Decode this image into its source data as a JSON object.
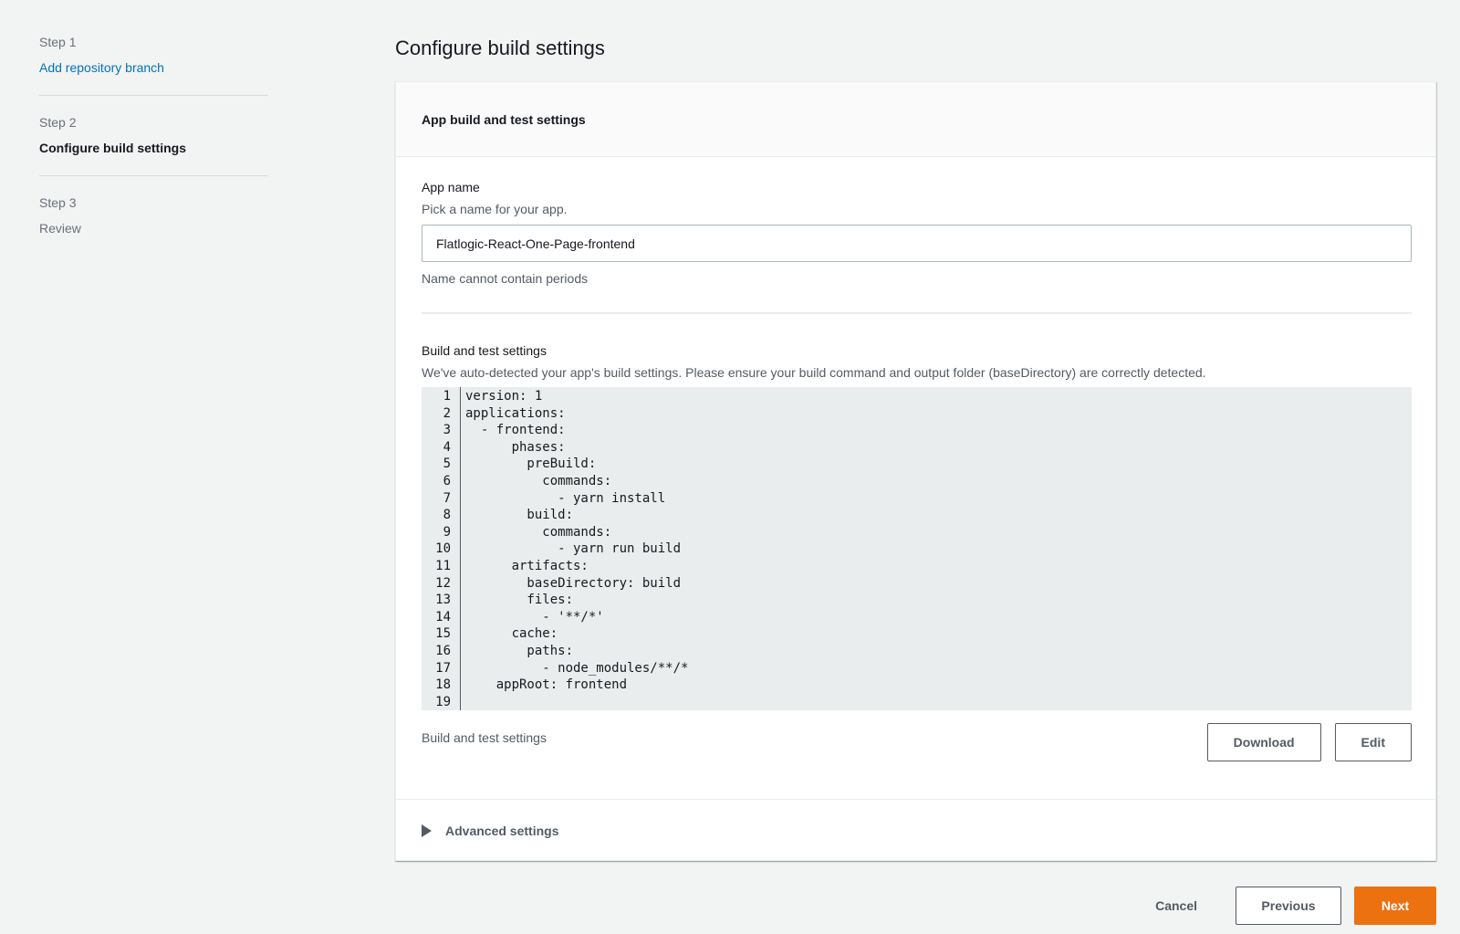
{
  "steps": [
    {
      "number": "Step 1",
      "label": "Add repository branch",
      "state": "link"
    },
    {
      "number": "Step 2",
      "label": "Configure build settings",
      "state": "current"
    },
    {
      "number": "Step 3",
      "label": "Review",
      "state": "disabled"
    }
  ],
  "page": {
    "title": "Configure build settings"
  },
  "panel": {
    "header": "App build and test settings",
    "app_name": {
      "label": "App name",
      "description": "Pick a name for your app.",
      "value": "Flatlogic-React-One-Page-frontend",
      "constraint": "Name cannot contain periods"
    },
    "build": {
      "label": "Build and test settings",
      "description": "We've auto-detected your app's build settings. Please ensure your build command and output folder (baseDirectory) are correctly detected.",
      "lines": [
        "version: 1",
        "applications:",
        "  - frontend:",
        "      phases:",
        "        preBuild:",
        "          commands:",
        "            - yarn install",
        "        build:",
        "          commands:",
        "            - yarn run build",
        "      artifacts:",
        "        baseDirectory: build",
        "        files:",
        "          - '**/*'",
        "      cache:",
        "        paths:",
        "          - node_modules/**/*",
        "    appRoot: frontend",
        ""
      ],
      "caption": "Build and test settings",
      "download_label": "Download",
      "edit_label": "Edit"
    },
    "advanced_label": "Advanced settings"
  },
  "actions": {
    "cancel": "Cancel",
    "previous": "Previous",
    "next": "Next"
  },
  "colors": {
    "accent": "#ec7211",
    "link": "#0073bb"
  }
}
